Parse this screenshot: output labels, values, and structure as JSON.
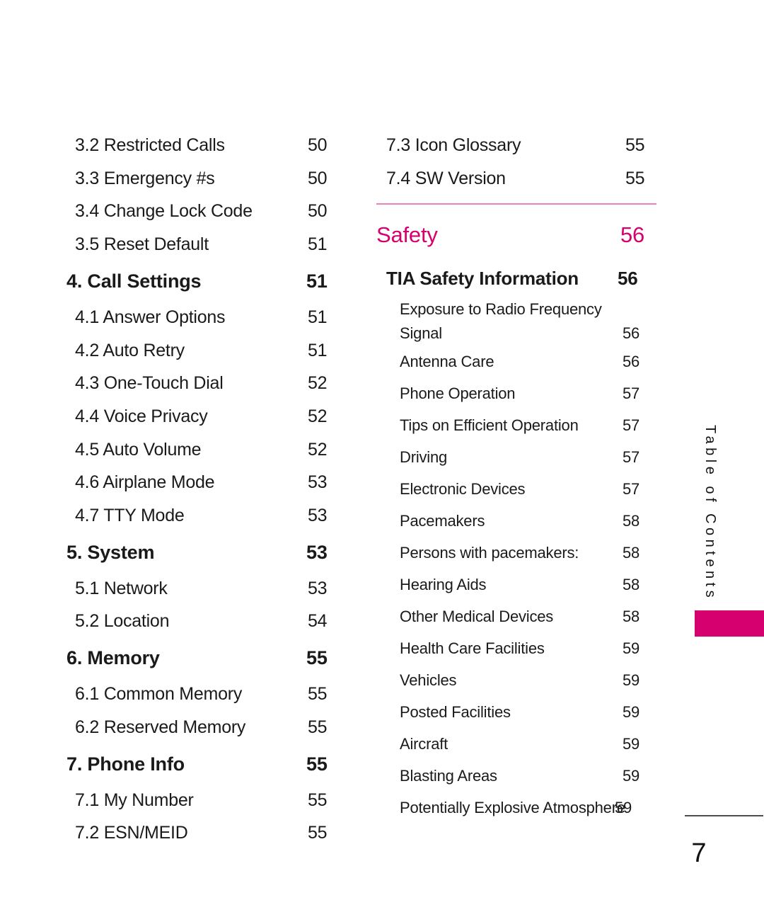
{
  "document": {
    "kind": "table-of-contents",
    "page_number": "7",
    "side_tab_label": "Table of Contents",
    "accent_color": "#d6006e",
    "rule_color": "#ef7fb4",
    "footer_rule_color": "#4d4d4d"
  },
  "left_column": [
    {
      "level": "lvl2",
      "label": "3.2 Restricted Calls",
      "page": "50"
    },
    {
      "level": "lvl2",
      "label": "3.3 Emergency #s",
      "page": "50"
    },
    {
      "level": "lvl2",
      "label": "3.4 Change Lock Code",
      "page": "50"
    },
    {
      "level": "lvl2",
      "label": "3.5 Reset Default",
      "page": "51"
    },
    {
      "level": "lvl1",
      "label": "4. Call Settings",
      "page": "51"
    },
    {
      "level": "lvl2",
      "label": "4.1 Answer Options",
      "page": "51"
    },
    {
      "level": "lvl2",
      "label": "4.2 Auto Retry",
      "page": "51"
    },
    {
      "level": "lvl2",
      "label": "4.3 One-Touch Dial",
      "page": "52"
    },
    {
      "level": "lvl2",
      "label": "4.4 Voice Privacy",
      "page": "52"
    },
    {
      "level": "lvl2",
      "label": "4.5 Auto Volume",
      "page": "52"
    },
    {
      "level": "lvl2",
      "label": "4.6 Airplane Mode",
      "page": "53"
    },
    {
      "level": "lvl2",
      "label": "4.7 TTY Mode",
      "page": "53"
    },
    {
      "level": "lvl1",
      "label": "5. System",
      "page": "53"
    },
    {
      "level": "lvl2",
      "label": "5.1 Network",
      "page": "53"
    },
    {
      "level": "lvl2",
      "label": "5.2 Location",
      "page": "54"
    },
    {
      "level": "lvl1",
      "label": "6. Memory",
      "page": "55"
    },
    {
      "level": "lvl2",
      "label": "6.1 Common Memory",
      "page": "55"
    },
    {
      "level": "lvl2",
      "label": "6.2 Reserved Memory",
      "page": "55"
    },
    {
      "level": "lvl1",
      "label": "7. Phone Info",
      "page": "55"
    },
    {
      "level": "lvl2",
      "label": "7.1 My Number",
      "page": "55"
    },
    {
      "level": "lvl2",
      "label": "7.2 ESN/MEID",
      "page": "55"
    }
  ],
  "right_column_top": [
    {
      "level": "lvl2",
      "label": "7.3 Icon Glossary",
      "page": "55"
    },
    {
      "level": "lvl2",
      "label": "7.4 SW Version",
      "page": "55"
    }
  ],
  "safety_section": {
    "heading": "Safety",
    "heading_page": "56",
    "subheading": "TIA Safety Information",
    "subheading_page": "56",
    "entries": [
      {
        "label_line1": "Exposure to Radio Frequency",
        "label_line2": "Signal",
        "page": "56",
        "wrapped": true
      },
      {
        "label": "Antenna Care",
        "page": "56"
      },
      {
        "label": "Phone Operation",
        "page": "57"
      },
      {
        "label": "Tips on Efficient Operation",
        "page": "57"
      },
      {
        "label": "Driving",
        "page": "57"
      },
      {
        "label": "Electronic Devices",
        "page": "57"
      },
      {
        "label": "Pacemakers",
        "page": "58"
      },
      {
        "label": "Persons with pacemakers:",
        "page": "58"
      },
      {
        "label": "Hearing Aids",
        "page": "58"
      },
      {
        "label": "Other Medical Devices",
        "page": "58"
      },
      {
        "label": "Health Care Facilities",
        "page": "59"
      },
      {
        "label": "Vehicles",
        "page": "59"
      },
      {
        "label": "Posted Facilities",
        "page": "59"
      },
      {
        "label": "Aircraft",
        "page": "59"
      },
      {
        "label": "Blasting Areas",
        "page": "59"
      },
      {
        "label": "Potentially Explosive Atmosphere",
        "page": "59",
        "wide": true
      }
    ]
  }
}
